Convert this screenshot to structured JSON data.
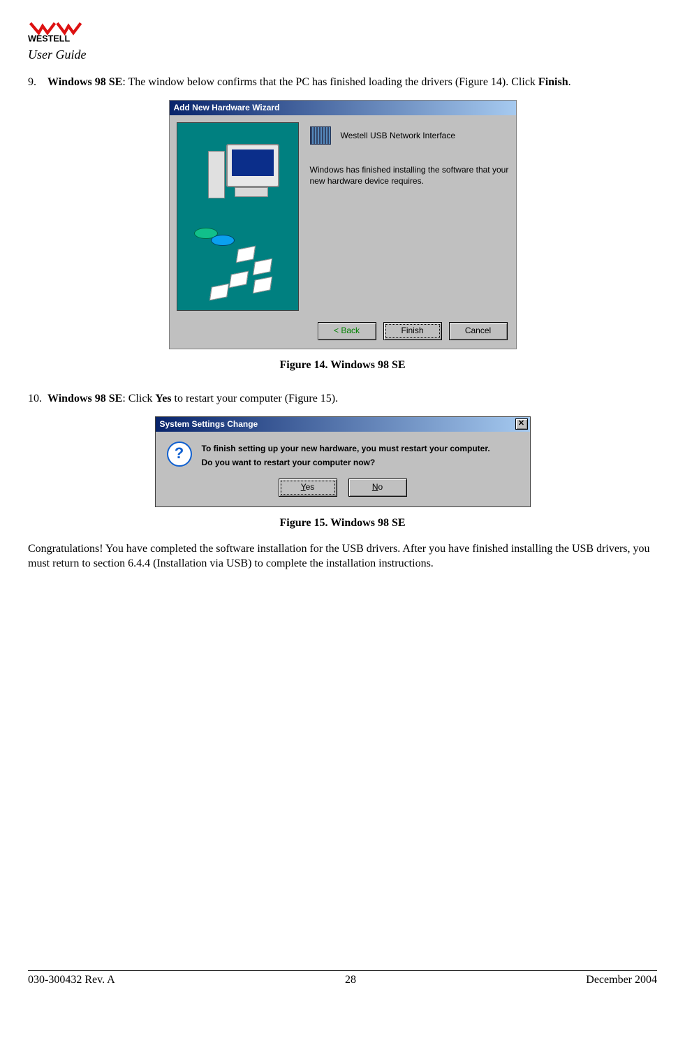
{
  "header": {
    "brand": "WESTELL",
    "subtitle": "User Guide"
  },
  "step9": {
    "num": "9.",
    "bold_lead": "Windows 98 SE",
    "text_after_lead": ": The window below confirms that the PC has finished loading the drivers (Figure 14). Click ",
    "bold_tail": "Finish",
    "period": "."
  },
  "dialog1": {
    "title": "Add New Hardware Wizard",
    "device_label": "Westell USB Network Interface",
    "message": "Windows has finished installing the software that your new hardware device requires.",
    "buttons": {
      "back": "< Back",
      "finish": "Finish",
      "cancel": "Cancel"
    }
  },
  "caption14": "Figure 14.  Windows 98 SE",
  "step10": {
    "num": "10.",
    "bold_lead": "Windows 98 SE",
    "text_after_lead": ": Click ",
    "bold_mid": "Yes",
    "text_tail": " to restart your computer (Figure 15)."
  },
  "dialog2": {
    "title": "System Settings Change",
    "line1": "To finish setting up your new hardware, you must restart your computer.",
    "line2": "Do you want to restart your computer now?",
    "yes_u": "Y",
    "yes_rest": "es",
    "no_u": "N",
    "no_rest": "o",
    "close": "✕"
  },
  "caption15": "Figure 15.  Windows 98 SE",
  "congrats": "Congratulations! You have completed the software installation for the USB drivers. After you have finished installing the USB drivers, you must return to section 6.4.4 (Installation via USB) to complete the installation instructions.",
  "footer": {
    "left": "030-300432 Rev. A",
    "center": "28",
    "right": "December 2004"
  }
}
